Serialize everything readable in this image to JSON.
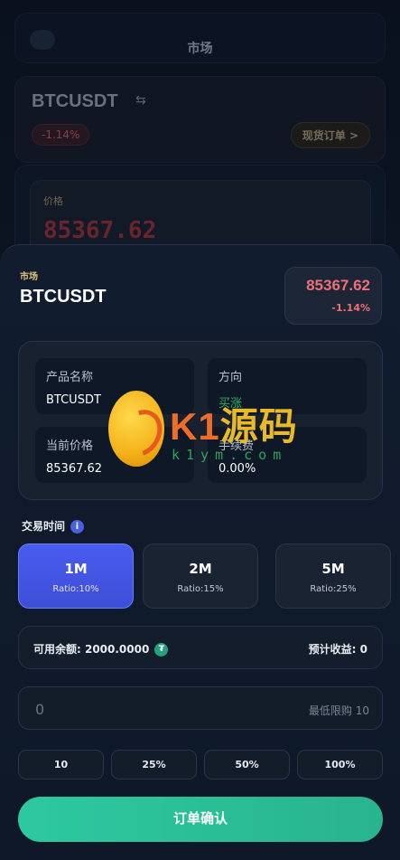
{
  "background": {
    "title": "市场",
    "pair": "BTCUSDT",
    "change": "-1.14%",
    "spot_order_button": "现货订单 >",
    "price_label": "价格",
    "price": "85367.62"
  },
  "sheet": {
    "market_label": "市场",
    "symbol": "BTCUSDT",
    "price": "85367.62",
    "change": "-1.14%",
    "info": {
      "product_label": "产品名称",
      "product_value": "BTCUSDT",
      "direction_label": "方向",
      "direction_value": "买涨",
      "current_price_label": "当前价格",
      "current_price_value": "85367.62",
      "fee_label": "手续费",
      "fee_value": "0.00%"
    },
    "trade_time_label": "交易时间",
    "info_icon_text": "i",
    "periods": [
      {
        "label": "1M",
        "ratio": "Ratio:10%"
      },
      {
        "label": "2M",
        "ratio": "Ratio:15%"
      },
      {
        "label": "5M",
        "ratio": "Ratio:25%"
      }
    ],
    "available_balance": "可用余额: 2000.0000",
    "usdt_icon_text": "₮",
    "expected_profit": "预计收益: 0",
    "amount_placeholder": "0",
    "min_purchase": "最低限购 10",
    "quick_amounts": [
      "10",
      "25%",
      "50%",
      "100%"
    ],
    "confirm_button": "订单确认"
  },
  "watermark": {
    "brand_latin": "K1",
    "brand_cn": "源码",
    "url": "k1ym.com"
  },
  "colors": {
    "accent": "#4a5cf0",
    "confirm": "#2dc9a0",
    "down": "#ef6f78",
    "up": "#2fae62"
  }
}
